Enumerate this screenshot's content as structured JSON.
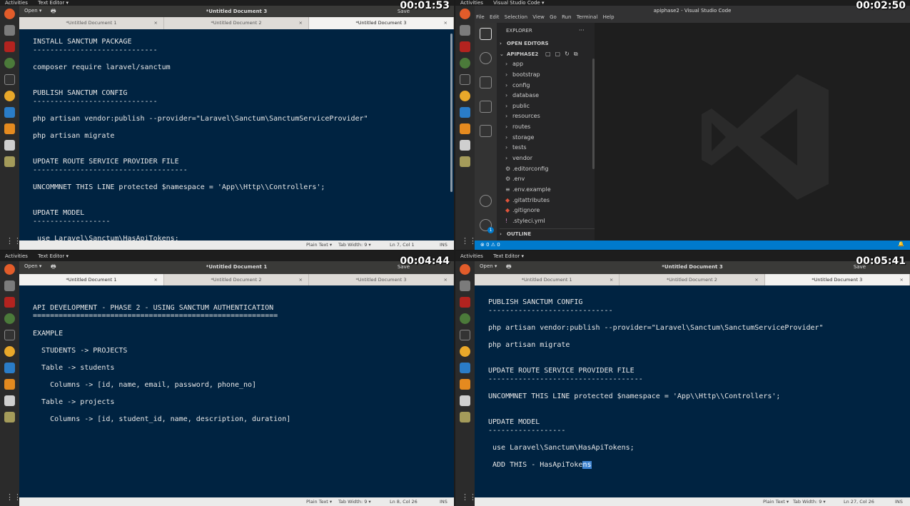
{
  "gnome": {
    "activities": "Activities",
    "text_editor_menu": "Text Editor ▾",
    "vscode_menu": "Visual Studio Code ▾"
  },
  "gedit": {
    "open_label": "Open ▾",
    "save_label": "Save",
    "tabs": [
      "*Untitled Document 1",
      "*Untitled Document 2",
      "*Untitled Document 3"
    ],
    "status_syntax": "Plain Text ▾",
    "status_tab": "Tab Width: 9 ▾",
    "status_ins": "INS"
  },
  "q1": {
    "timer": "00:01:53",
    "doc_title": "*Untitled Document 3",
    "cursor": "Ln 7, Col 1",
    "lines": [
      "INSTALL SANCTUM PACKAGE",
      "-----------------------------",
      "composer require laravel/sanctum",
      "PUBLISH SANCTUM CONFIG",
      "-----------------------------",
      "php artisan vendor:publish --provider=\"Laravel\\Sanctum\\SanctumServiceProvider\"",
      "php artisan migrate",
      "UPDATE ROUTE SERVICE PROVIDER FILE",
      "------------------------------------",
      "UNCOMMNET THIS LINE protected $namespace = 'App\\\\Http\\\\Controllers';",
      "UPDATE MODEL",
      "------------------",
      " use Laravel\\Sanctum\\HasApiTokens;"
    ]
  },
  "q2": {
    "timer": "00:02:50",
    "window_title": "apiphase2 - Visual Studio Code",
    "menu": [
      "File",
      "Edit",
      "Selection",
      "View",
      "Go",
      "Run",
      "Terminal",
      "Help"
    ],
    "explorer": "EXPLORER",
    "explorer_more": "···",
    "open_editors": "OPEN EDITORS",
    "project": "APIPHASE2",
    "folders": [
      "app",
      "bootstrap",
      "config",
      "database",
      "public",
      "resources",
      "routes",
      "storage",
      "tests",
      "vendor"
    ],
    "files": [
      ".editorconfig",
      ".env",
      ".env.example",
      ".gitattributes",
      ".gitignore",
      ".styleci.yml"
    ],
    "file_icons": [
      "⚙",
      "⚙",
      "≡",
      "◆",
      "◆",
      "!"
    ],
    "outline": "OUTLINE",
    "status_left": "⊗ 0 ⚠ 0",
    "badge": "1"
  },
  "q3": {
    "timer": "00:04:44",
    "doc_title": "*Untitled Document 1",
    "cursor": "Ln 8, Col 26",
    "lines": [
      "API DEVELOPMENT - PHASE 2 - USING SANCTUM AUTHENTICATION",
      "=========================================================",
      "EXAMPLE",
      "  STUDENTS -> PROJECTS",
      "  Table -> students",
      "    Columns -> [id, name, email, password, phone_no]",
      "  Table -> projects",
      "    Columns -> [id, student_id, name, description, duration]"
    ]
  },
  "q4": {
    "timer": "00:05:41",
    "doc_title": "*Untitled Document 3",
    "cursor": "Ln 27, Col 26",
    "lines": [
      "PUBLISH SANCTUM CONFIG",
      "-----------------------------",
      "php artisan vendor:publish --provider=\"Laravel\\Sanctum\\SanctumServiceProvider\"",
      "php artisan migrate",
      "UPDATE ROUTE SERVICE PROVIDER FILE",
      "------------------------------------",
      "UNCOMMNET THIS LINE protected $namespace = 'App\\\\Http\\\\Controllers';",
      "UPDATE MODEL",
      "------------------",
      " use Laravel\\Sanctum\\HasApiTokens;",
      " ADD THIS - HasApiToke",
      "ns"
    ]
  },
  "colors": {
    "editor_bg": "#002341",
    "selection": "#3d83d1",
    "vscode_status": "#007acc"
  }
}
